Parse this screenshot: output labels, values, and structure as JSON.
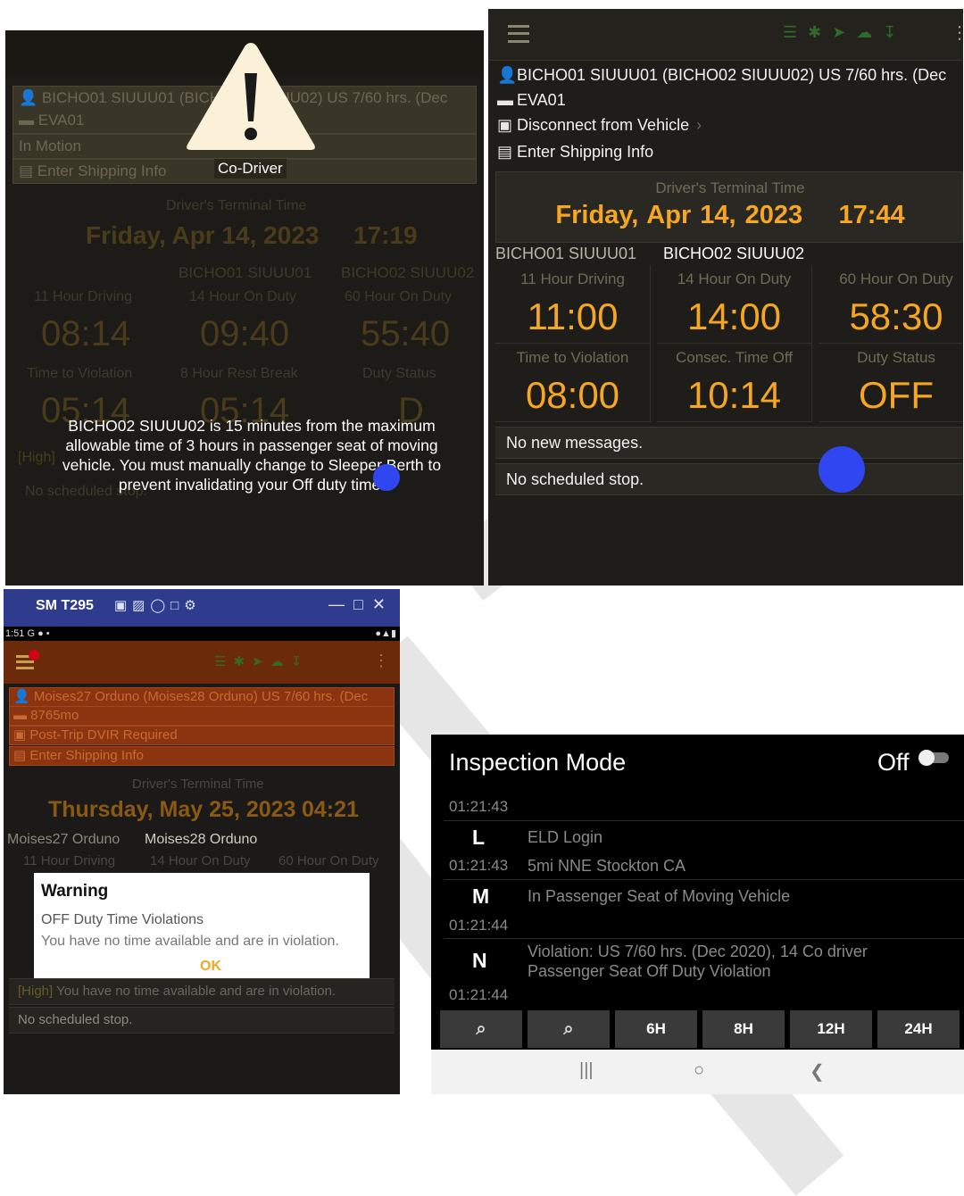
{
  "panel1": {
    "driver_line": "BICHO01 SIUUU01 (BICHO02 SIUUU02) US 7/60 hrs. (Dec",
    "vehicle": "EVA01",
    "motion": "In Motion",
    "shipping": "Enter Shipping Info",
    "alert_title": "Co-Driver",
    "terminal_label": "Driver's Terminal Time",
    "date": "Friday, Apr 14, 2023",
    "time": "17:19",
    "name1": "BICHO01 SIUUU01",
    "name2": "BICHO02 SIUUU02",
    "labels_row1": [
      "11 Hour Driving",
      "14 Hour On Duty",
      "60 Hour On Duty"
    ],
    "values_row1": [
      "08:14",
      "09:40",
      "55:40"
    ],
    "labels_row2": [
      "Time to Violation",
      "8 Hour Rest Break",
      "Duty Status"
    ],
    "values_row2": [
      "05:14",
      "05:14",
      "D"
    ],
    "alert_message": "BICHO02 SIUUU02 is 15 minutes from the maximum allowable time of 3 hours in passenger seat of moving vehicle. You must manually change to Sleeper Berth to prevent invalidating your Off duty time.",
    "high_tag": "[High]",
    "sched": "No scheduled stop."
  },
  "panel2": {
    "driver_line": "BICHO01 SIUUU01 (BICHO02 SIUUU02) US 7/60 hrs. (Dec",
    "vehicle": "EVA01",
    "disconnect": "Disconnect from Vehicle",
    "shipping": "Enter Shipping Info",
    "terminal_label": "Driver's Terminal Time",
    "date": "Friday, Apr 14, 2023",
    "time": "17:44",
    "name1": "BICHO01 SIUUU01",
    "name2": "BICHO02 SIUUU02",
    "cells": [
      {
        "label": "11 Hour Driving",
        "value": "11:00"
      },
      {
        "label": "14 Hour On Duty",
        "value": "14:00"
      },
      {
        "label": "60 Hour On Duty",
        "value": "58:30"
      },
      {
        "label": "Time to Violation",
        "value": "08:00"
      },
      {
        "label": "Consec. Time Off",
        "value": "10:14"
      },
      {
        "label": "Duty Status",
        "value": "OFF"
      }
    ],
    "messages": "No new messages.",
    "sched": "No scheduled stop."
  },
  "panel3": {
    "window_title": "SM T295",
    "status_time": "1:51",
    "driver_line": "Moises27 Orduno (Moises28 Orduno) US 7/60 hrs. (Dec",
    "vehicle": "8765mo",
    "dvir": "Post-Trip DVIR Required",
    "shipping": "Enter Shipping Info",
    "terminal_label": "Driver's Terminal Time",
    "date": "Thursday, May 25, 2023",
    "time": "04:21",
    "name1": "Moises27 Orduno",
    "name2": "Moises28 Orduno",
    "labels_row1": [
      "11 Hour Driving",
      "14 Hour On Duty",
      "60 Hour On Duty"
    ],
    "dialog": {
      "title": "Warning",
      "heading": "OFF Duty Time Violations",
      "body": "You have no time available and are in violation.",
      "ok": "OK"
    },
    "high_tag": "[High]",
    "high_msg": "You have no time available and are in violation.",
    "sched": "No scheduled stop."
  },
  "panel4": {
    "title": "Inspection Mode",
    "toggle_label": "Off",
    "events": [
      {
        "time": "01:21:43",
        "code": "L",
        "text": "ELD Login",
        "location": ""
      },
      {
        "time": "01:21:43",
        "code": "M",
        "text": "In Passenger Seat of Moving Vehicle",
        "location": "5mi NNE Stockton CA"
      },
      {
        "time": "01:21:44",
        "code": "N",
        "text": "Violation: US 7/60 hrs. (Dec 2020), 14 Co driver Passenger Seat Off Duty Violation",
        "location": ""
      }
    ],
    "last_time": "01:21:44",
    "zoom_buttons": [
      "6H",
      "8H",
      "12H",
      "24H"
    ]
  },
  "icons": [
    "person-icon",
    "truck-icon",
    "document-icon",
    "shipping-icon",
    "warning-triangle-icon",
    "zoom-in-icon",
    "zoom-out-icon"
  ]
}
